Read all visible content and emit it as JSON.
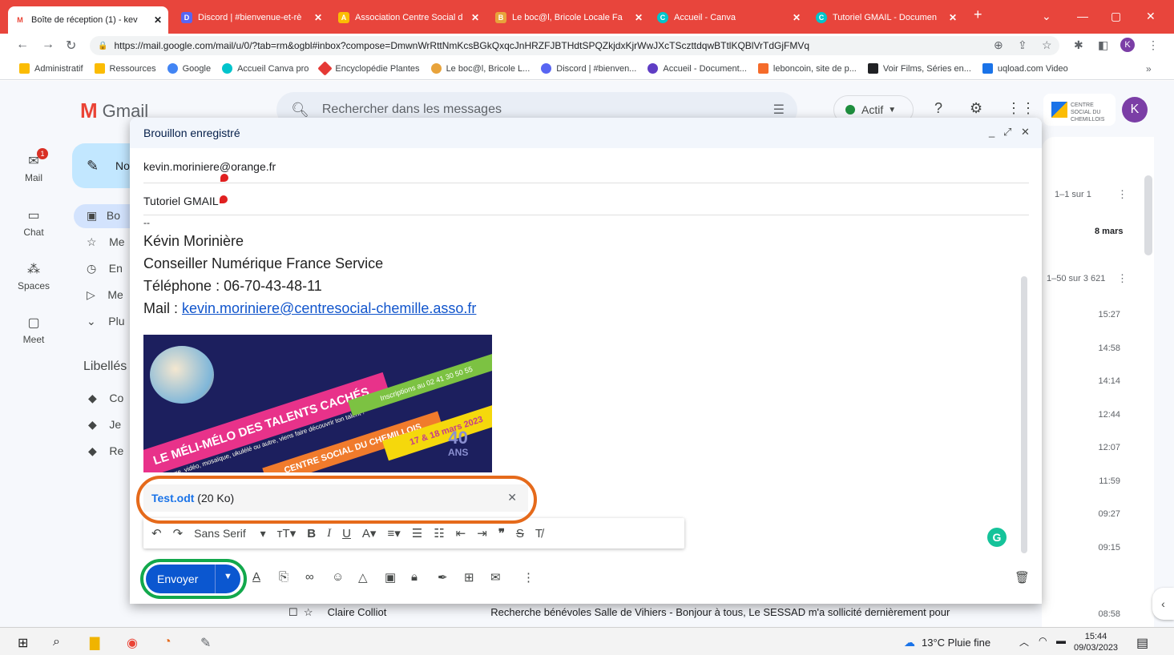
{
  "browser": {
    "tabs": [
      {
        "title": "Boîte de réception (1) - kev",
        "color": "#ea4335",
        "glyph": "M"
      },
      {
        "title": "Discord | #bienvenue-et-rè",
        "color": "#5865f2",
        "glyph": "D"
      },
      {
        "title": "Association Centre Social d",
        "color": "#fbbc04",
        "glyph": "A"
      },
      {
        "title": "Le boc@l, Bricole Locale Fa",
        "color": "#e8a33b",
        "glyph": "B"
      },
      {
        "title": "Accueil - Canva",
        "color": "#00c4cc",
        "glyph": "C"
      },
      {
        "title": "Tutoriel GMAIL - Documen",
        "color": "#00c4cc",
        "glyph": "C"
      }
    ],
    "new_tab": "+",
    "url": "https://mail.google.com/mail/u/0/?tab=rm&ogbl#inbox?compose=DmwnWrRttNmKcsBGkQxqcJnHRZFJBTHdtSPQZkjdxKjrWwJXcTSczttdqwBTtlKQBlVrTdGjFMVq",
    "profile_initial": "K",
    "bookmarks": [
      {
        "label": "Administratif",
        "color": "#fbbc04"
      },
      {
        "label": "Ressources",
        "color": "#fbbc04"
      },
      {
        "label": "Google",
        "color": "#4285f4"
      },
      {
        "label": "Accueil Canva pro",
        "color": "#00c4cc"
      },
      {
        "label": "Encyclopédie Plantes",
        "color": "#e53935"
      },
      {
        "label": "Le boc@l, Bricole L...",
        "color": "#e8a33b"
      },
      {
        "label": "Discord | #bienven...",
        "color": "#5865f2"
      },
      {
        "label": "Accueil - Document...",
        "color": "#5f3dc4"
      },
      {
        "label": "leboncoin, site de p...",
        "color": "#f56b2a"
      },
      {
        "label": "Voir Films, Séries en...",
        "color": "#202124"
      },
      {
        "label": "uqload.com Video",
        "color": "#1a73e8"
      }
    ],
    "more_bookmarks": "»"
  },
  "gmail": {
    "app_name": "Gmail",
    "search_placeholder": "Rechercher dans les messages",
    "status": "Actif",
    "avatar_initial": "K",
    "org_logo_text": "CENTRE SOCIAL DU CHEMILLOIS",
    "rail": [
      {
        "label": "Mail",
        "icon": "mail-icon",
        "badge": "1"
      },
      {
        "label": "Chat",
        "icon": "chat-icon"
      },
      {
        "label": "Spaces",
        "icon": "spaces-icon"
      },
      {
        "label": "Meet",
        "icon": "meet-icon"
      }
    ],
    "compose_button_partial": "No",
    "nav_partial": [
      "Bo",
      "Me",
      "En",
      "Me",
      "Plu"
    ],
    "labels_heading": "Libellés",
    "labels_partial": [
      "Co",
      "Je",
      "Re"
    ],
    "list": {
      "range_top": "1–1 sur 1",
      "date_top": "8 mars",
      "range_main": "1–50 sur 3 621",
      "times": [
        "15:27",
        "14:58",
        "14:14",
        "12:44",
        "12:07",
        "11:59",
        "09:27",
        "09:15",
        "08:58"
      ]
    },
    "bottom_row": {
      "sender": "Claire Colliot",
      "subject": "Recherche bénévoles Salle de Vihiers - Bonjour à tous, Le SESSAD m'a sollicité dernièrement pour"
    }
  },
  "compose": {
    "title": "Brouillon enregistré",
    "to": "kevin.moriniere@orange.fr",
    "subject": "Tutoriel GMAIL",
    "signature": {
      "dash": "--",
      "name": "Kévin Morinière",
      "role": "Conseiller Numérique France Service",
      "phone": "Téléphone : 06-70-43-48-11",
      "mail_prefix": "Mail : ",
      "mail": "kevin.moriniere@centresocial-chemille.asso.fr"
    },
    "flyer": {
      "headline": "LE MÉLI-MÉLO DES TALENTS CACHÉS",
      "sub": "Peinture, vidéo, mosaïque, ukulélé ou autre, viens faire découvrir ton talent !",
      "phone": "Inscriptions au 02 41 30 50 55",
      "org": "CENTRE SOCIAL DU CHEMILLOIS",
      "dates": "17 & 18 mars 2023",
      "anniversary": "40",
      "anniversary_unit": "ANS"
    },
    "attachment": {
      "name": "Test.odt",
      "size": "(20 Ko)"
    },
    "toolbar": {
      "font": "Sans Serif"
    },
    "send_label": "Envoyer"
  },
  "taskbar": {
    "weather": "13°C  Pluie fine",
    "time": "15:44",
    "date": "09/03/2023"
  }
}
